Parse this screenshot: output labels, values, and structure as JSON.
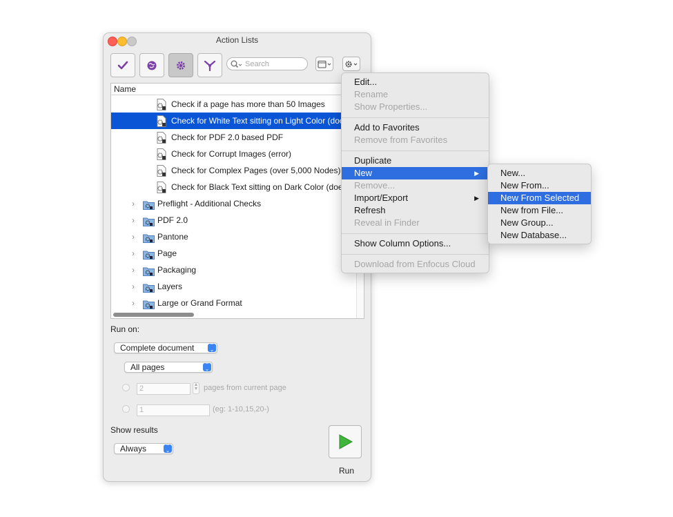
{
  "window": {
    "title": "Action Lists",
    "search_placeholder": "Search"
  },
  "table": {
    "column_header": "Name",
    "items": [
      {
        "label": "Check if a page has more than 50 Images",
        "kind": "doc",
        "selected": false
      },
      {
        "label": "Check for White Text sitting on Light Color (doc",
        "kind": "doc",
        "selected": true
      },
      {
        "label": "Check for PDF 2.0 based PDF",
        "kind": "doc",
        "selected": false
      },
      {
        "label": "Check for Corrupt Images (error)",
        "kind": "doc",
        "selected": false
      },
      {
        "label": "Check for Complex Pages (over 5,000 Nodes)",
        "kind": "doc",
        "selected": false
      },
      {
        "label": "Check for Black Text sitting on Dark Color (doe",
        "kind": "doc",
        "selected": false
      },
      {
        "label": "Preflight - Additional Checks",
        "kind": "folder",
        "selected": false
      },
      {
        "label": "PDF 2.0",
        "kind": "folder",
        "selected": false
      },
      {
        "label": "Pantone",
        "kind": "folder",
        "selected": false
      },
      {
        "label": "Page",
        "kind": "folder",
        "selected": false
      },
      {
        "label": "Packaging",
        "kind": "folder",
        "selected": false
      },
      {
        "label": "Layers",
        "kind": "folder",
        "selected": false
      },
      {
        "label": "Large or Grand Format",
        "kind": "folder",
        "selected": false
      }
    ]
  },
  "run_on": {
    "label": "Run on:",
    "scope_value": "Complete document",
    "pages_value": "All pages",
    "pages_count_value": "2",
    "pages_from_label": "pages from current page",
    "range_value": "1",
    "range_hint": "(eg: 1-10,15,20-)"
  },
  "show_results": {
    "label": "Show results",
    "value": "Always"
  },
  "run": {
    "label": "Run"
  },
  "context_menu": {
    "items": [
      {
        "label": "Edit...",
        "disabled": false
      },
      {
        "label": "Rename",
        "disabled": true
      },
      {
        "label": "Show Properties...",
        "disabled": true
      },
      {
        "label": "Add to Favorites",
        "disabled": false
      },
      {
        "label": "Remove from Favorites",
        "disabled": true
      },
      {
        "label": "Duplicate",
        "disabled": false
      },
      {
        "label": "New",
        "disabled": false
      },
      {
        "label": "Remove...",
        "disabled": true
      },
      {
        "label": "Import/Export",
        "disabled": false
      },
      {
        "label": "Refresh",
        "disabled": false
      },
      {
        "label": "Reveal in Finder",
        "disabled": true
      },
      {
        "label": "Show Column Options...",
        "disabled": false
      },
      {
        "label": "Download from Enfocus Cloud",
        "disabled": true
      }
    ]
  },
  "submenu": {
    "items": [
      {
        "label": "New..."
      },
      {
        "label": "New From..."
      },
      {
        "label": "New From Selected"
      },
      {
        "label": "New from File..."
      },
      {
        "label": "New Group..."
      },
      {
        "label": "New Database..."
      }
    ]
  },
  "colors": {
    "selection": "#0a55d6",
    "menu_highlight": "#2e6ee0",
    "accent_purple": "#7b3fa8",
    "run_green": "#3fb53a"
  }
}
